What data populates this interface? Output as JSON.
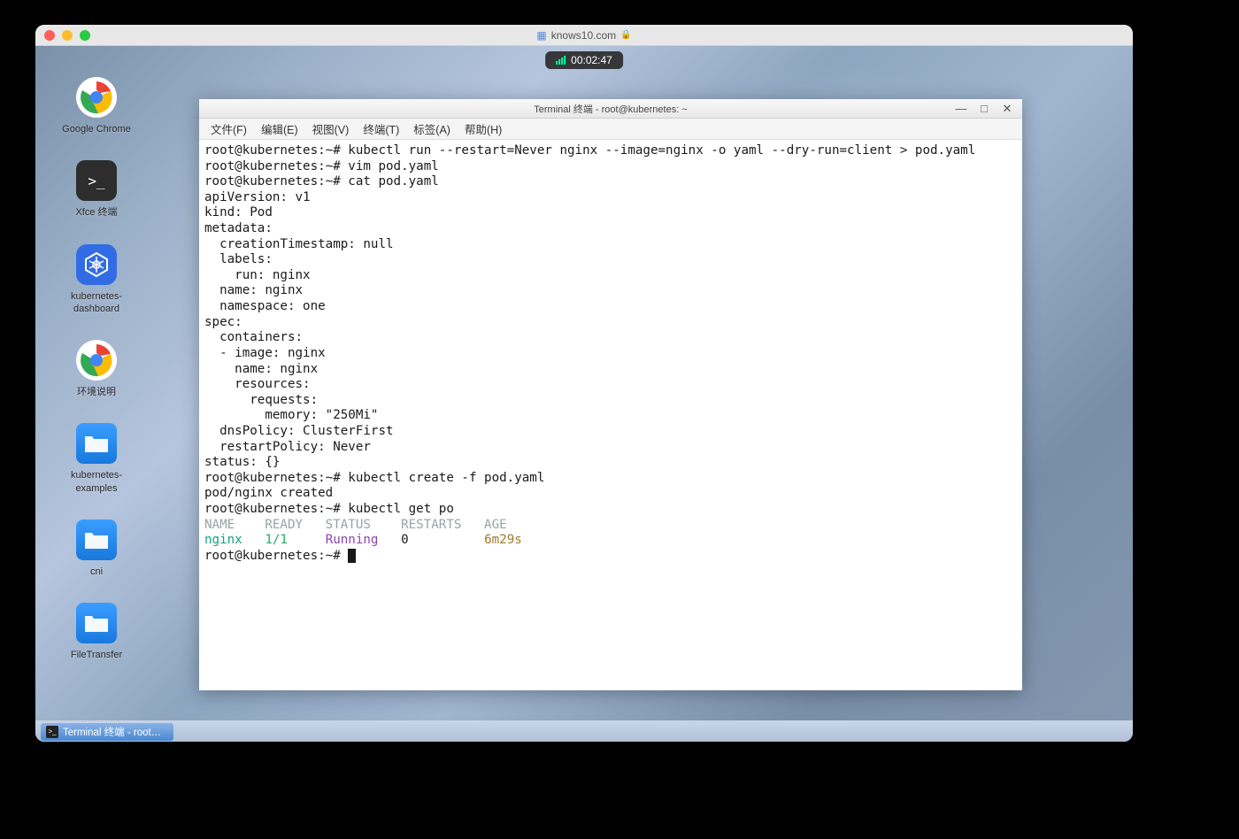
{
  "browser": {
    "url": "knows10.com",
    "timer": "00:02:47"
  },
  "desktop_icons": [
    {
      "label": "Google Chrome"
    },
    {
      "label": "Xfce 终端"
    },
    {
      "label": "kubernetes-\ndashboard"
    },
    {
      "label": "环境说明"
    },
    {
      "label": "kubernetes-\nexamples"
    },
    {
      "label": "cni"
    },
    {
      "label": "FileTransfer"
    }
  ],
  "terminal": {
    "title": "Terminal 终端 - root@kubernetes: ~",
    "menus": [
      "文件(F)",
      "编辑(E)",
      "视图(V)",
      "终端(T)",
      "标签(A)",
      "帮助(H)"
    ],
    "prompt": "root@kubernetes:~# ",
    "lines": {
      "cmd1": "kubectl run --restart=Never nginx --image=nginx -o yaml --dry-run=client > pod.yaml",
      "cmd2": "vim pod.yaml",
      "cmd3": "cat pod.yaml",
      "yaml01": "apiVersion: v1",
      "yaml02": "kind: Pod",
      "yaml03": "metadata:",
      "yaml04": "  creationTimestamp: null",
      "yaml05": "  labels:",
      "yaml06": "    run: nginx",
      "yaml07": "  name: nginx",
      "yaml08": "  namespace: one",
      "yaml09": "spec:",
      "yaml10": "  containers:",
      "yaml11": "  - image: nginx",
      "yaml12": "    name: nginx",
      "yaml13": "    resources:",
      "yaml14": "      requests:",
      "yaml15": "        memory: \"250Mi\"",
      "yaml16": "  dnsPolicy: ClusterFirst",
      "yaml17": "  restartPolicy: Never",
      "yaml18": "status: {}",
      "cmd4": "kubectl create -f pod.yaml",
      "out1": "pod/nginx created",
      "cmd5": "kubectl get po",
      "hdr": "NAME    READY   STATUS    RESTARTS   AGE",
      "row_name": "nginx",
      "row_ready": "1/1",
      "row_status": "Running",
      "row_restarts": "0",
      "row_age": "6m29s"
    }
  },
  "taskbar": {
    "item1": "Terminal 终端 - root…"
  }
}
